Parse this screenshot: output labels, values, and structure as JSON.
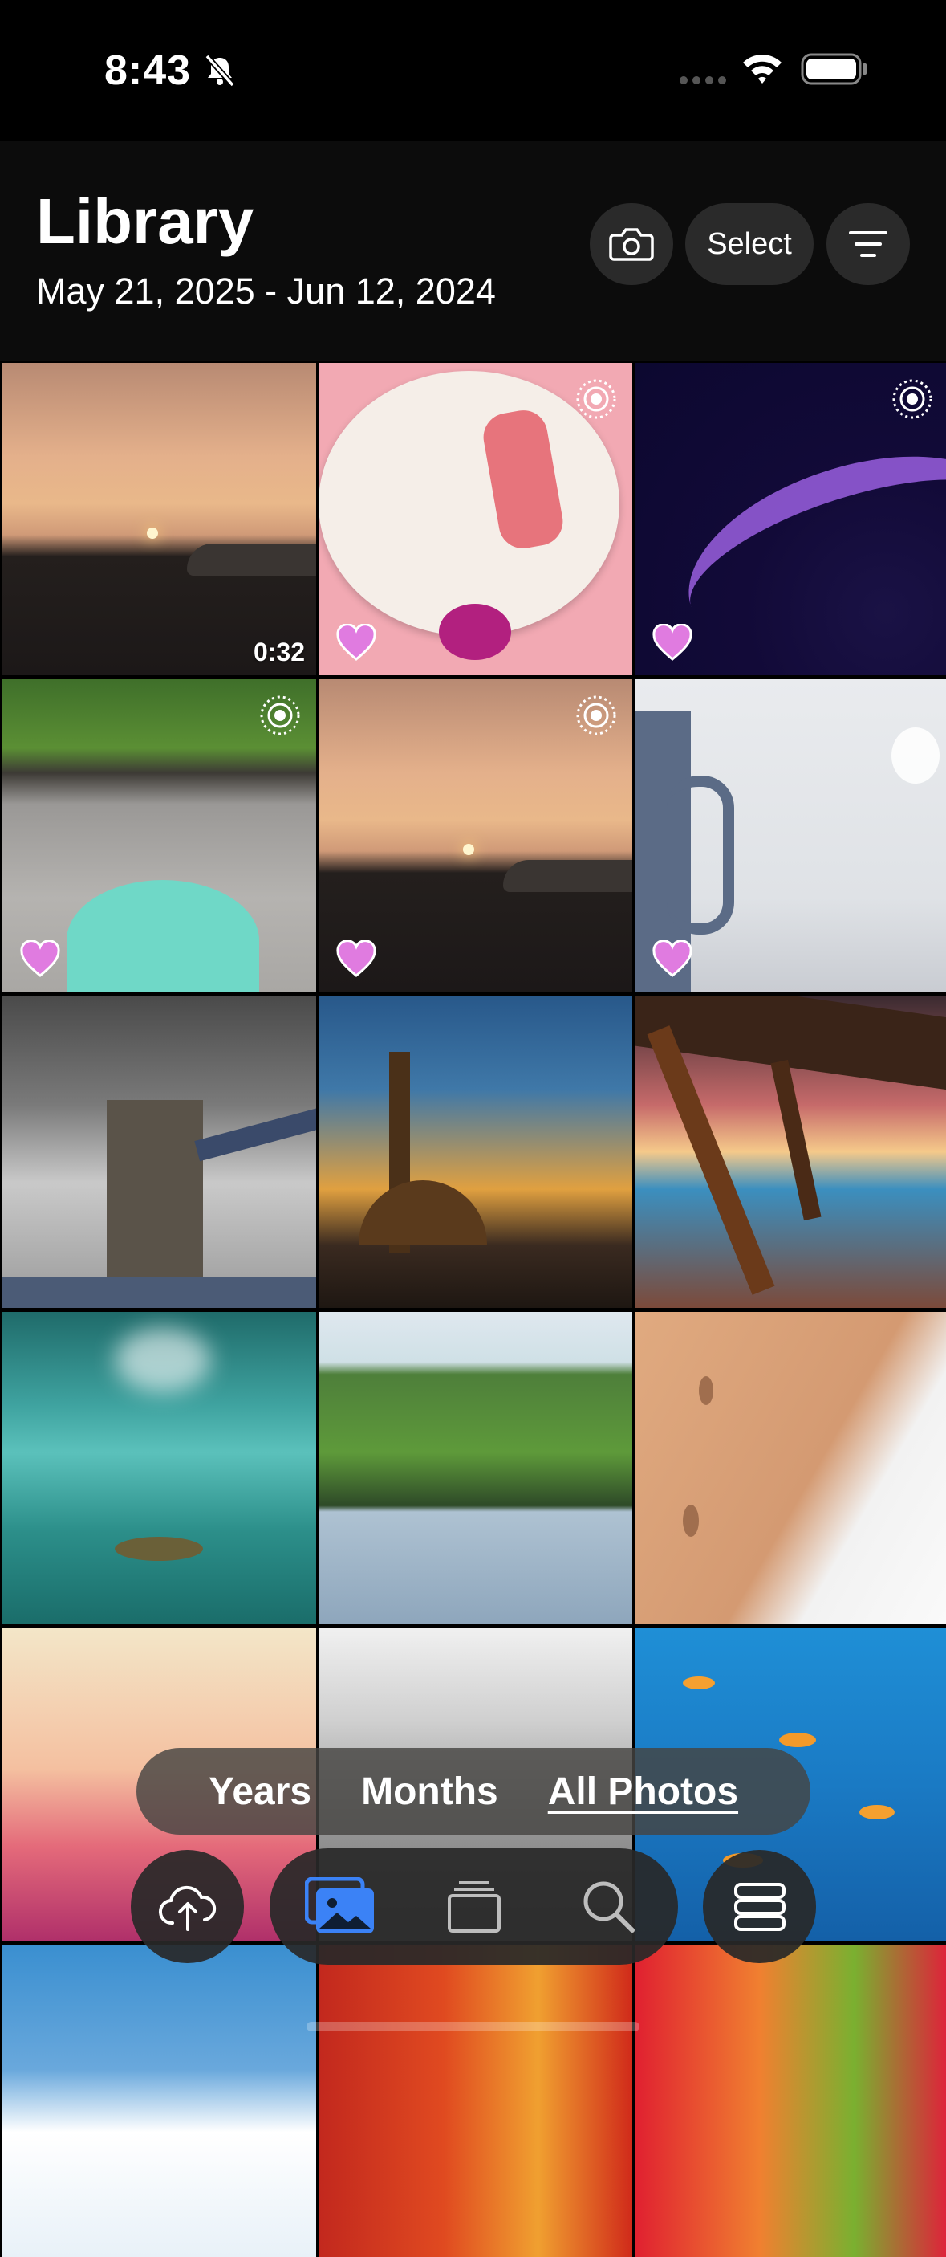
{
  "status_bar": {
    "time": "8:43"
  },
  "header": {
    "title": "Library",
    "date_range": "May 21, 2025 - Jun 12, 2024",
    "select_label": "Select"
  },
  "photos": [
    {
      "duration": "0:32"
    }
  ],
  "view_switcher": {
    "years_label": "Years",
    "months_label": "Months",
    "all_photos_label": "All Photos",
    "active": "All Photos"
  },
  "colors": {
    "favorite": "#e07be0",
    "selected_tab": "#3b82f6"
  }
}
